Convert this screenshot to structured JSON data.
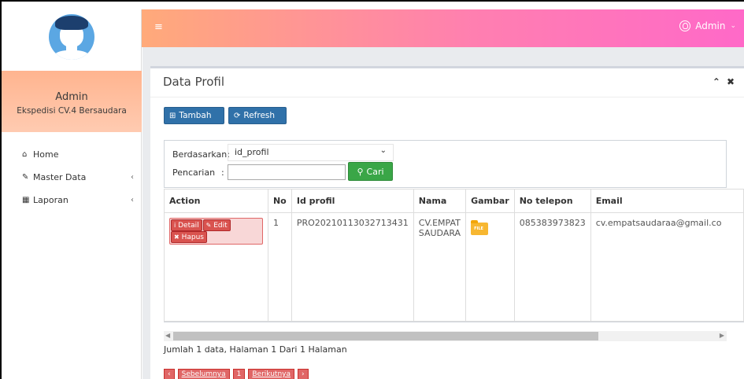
{
  "header": {
    "menu_icon": "hamburger-icon",
    "user_name": "Admin",
    "user_icon": "user-circle-icon"
  },
  "sidebar": {
    "admin_name": "Admin",
    "admin_subtitle": "Ekspedisi CV.4 Bersaudara",
    "items": [
      {
        "label": "Home",
        "icon": "home-icon",
        "has_arrow": false
      },
      {
        "label": "Master Data",
        "icon": "edit-icon",
        "has_arrow": true
      },
      {
        "label": "Laporan",
        "icon": "calendar-icon",
        "has_arrow": true
      }
    ]
  },
  "panel": {
    "title": "Data Profil",
    "collapse_icon": "chevron-up-icon",
    "close_icon": "close-icon"
  },
  "toolbar": {
    "add_label": "Tambah",
    "refresh_label": "Refresh"
  },
  "filter": {
    "by_label": "Berdasarkan:",
    "by_value": "id_profil",
    "search_label": "Pencarian",
    "search_value": "",
    "search_button": "Cari"
  },
  "table": {
    "headers": [
      "Action",
      "No",
      "Id profil",
      "Nama",
      "Gambar",
      "No telepon",
      "Email"
    ],
    "rows": [
      {
        "actions": [
          "Detail",
          "Edit",
          "Hapus"
        ],
        "no": "1",
        "id_profil": "PRO20210113032713431",
        "nama": "CV.EMPAT SAUDARA",
        "gambar_label": "FILE",
        "no_telepon": "085383973823",
        "email": "cv.empatsaudaraa@gmail.co"
      }
    ]
  },
  "footer": {
    "page_info": "Jumlah 1 data, Halaman 1 Dari 1 Halaman",
    "pager": [
      "‹",
      "Sebelumnya",
      "1",
      "Berikutnya",
      "›"
    ]
  },
  "colors": {
    "header_gradient_start": "#ffaa7a",
    "header_gradient_end": "#ff69c8",
    "primary_button": "#3071a9",
    "success_button": "#3aa647",
    "danger_button": "#d9534f"
  }
}
